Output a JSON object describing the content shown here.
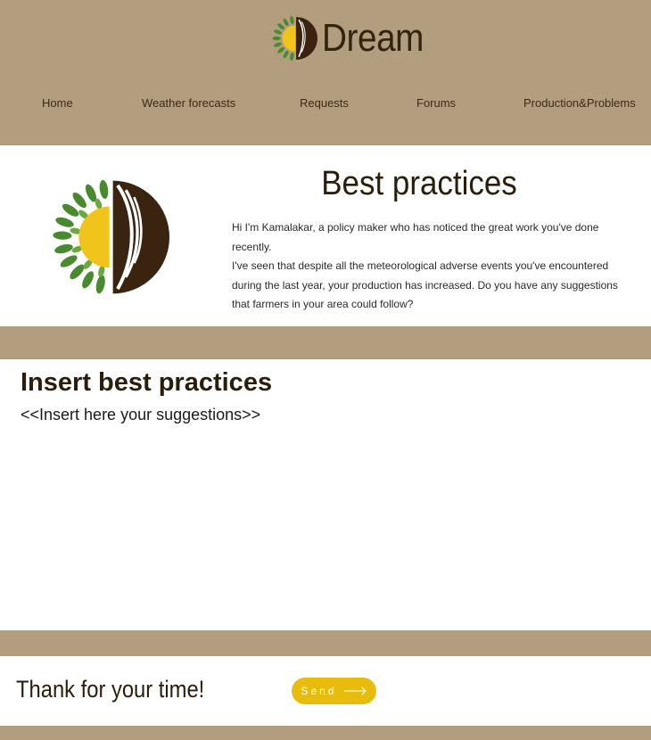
{
  "brand": {
    "name": "Dream",
    "logo_icon": "wheat-sun-leaf-logo-icon"
  },
  "nav": {
    "items": [
      {
        "label": "Home"
      },
      {
        "label": "Weather forecasts"
      },
      {
        "label": "Requests"
      },
      {
        "label": "Forums"
      },
      {
        "label": "Production&Problems"
      }
    ]
  },
  "hero": {
    "title": "Best practices",
    "intro_line1": "Hi I'm Kamalakar, a policy maker who has noticed the great work you've done recently.",
    "intro_line2": "I've seen that despite all the meteorological adverse events you've encountered during the last year, your production has increased. Do you have any suggestions that farmers in your area could follow?"
  },
  "practices": {
    "heading": "Insert best practices",
    "input_placeholder": "<<Insert here your suggestions>>",
    "input_value": ""
  },
  "footer": {
    "thanks": "Thank for your time!",
    "send_label": "Send",
    "send_icon": "arrow-right-icon"
  },
  "colors": {
    "background_tan": "#b39d7f",
    "dark_brown": "#33240f",
    "button_yellow": "#e8bc0d",
    "logo_green": "#4a8a2e",
    "logo_yellow": "#f0c41a"
  }
}
